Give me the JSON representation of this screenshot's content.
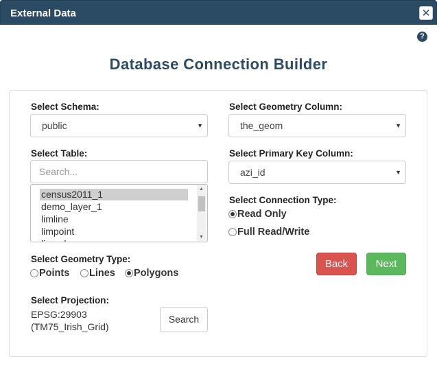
{
  "window": {
    "title": "External Data",
    "close_icon": "close-icon"
  },
  "help_icon_glyph": "?",
  "page_title": "Database Connection Builder",
  "schema": {
    "label": "Select Schema:",
    "value": "public"
  },
  "table": {
    "label": "Select Table:",
    "search_placeholder": "Search...",
    "items": [
      "census2011_1",
      "demo_layer_1",
      "limline",
      "limpoint",
      "limpoly"
    ],
    "selected_index": 0
  },
  "geometry_type": {
    "label": "Select Geometry Type:",
    "options": [
      "Points",
      "Lines",
      "Polygons"
    ],
    "selected": "Polygons"
  },
  "projection": {
    "label": "Select Projection:",
    "code": "EPSG:29903",
    "name": "(TM75_Irish_Grid)",
    "search_button": "Search"
  },
  "geometry_column": {
    "label": "Select Geometry Column:",
    "value": "the_geom"
  },
  "primary_key": {
    "label": "Select Primary Key Column:",
    "value": "azi_id"
  },
  "connection_type": {
    "label": "Select Connection Type:",
    "options": [
      "Read Only",
      "Full Read/Write"
    ],
    "selected": "Read Only"
  },
  "buttons": {
    "back": "Back",
    "next": "Next",
    "back_color": "#d9534f",
    "next_color": "#5cb85c"
  },
  "colors": {
    "titlebar": "#2b4a63",
    "heading": "#2b4a63"
  }
}
